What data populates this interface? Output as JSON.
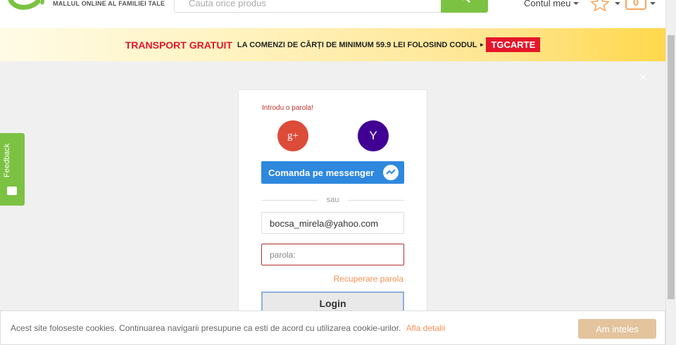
{
  "header": {
    "tagline": "MALLUL ONLINE AL FAMILIEI TALE",
    "search_placeholder": "Cauta orice produs",
    "account_label": "Contul meu",
    "cart_count": "0"
  },
  "promo": {
    "strong": "TRANSPORT GRATUIT",
    "text": "LA COMENZI DE CĂRȚI DE MINIMUM 59.9 LEI FOLOSIND CODUL",
    "arrow": "►",
    "code": "TGCARTE"
  },
  "overlay": {
    "close": "×"
  },
  "feedback": {
    "label": "Feedback"
  },
  "login": {
    "error": "Introdu o parola!",
    "google": "g+",
    "yahoo": "Y",
    "messenger_label": "Comanda pe messenger",
    "separator": "sau",
    "email_value": "bocsa_mirela@yahoo.com",
    "password_placeholder": "parola:",
    "recover_link": "Recuperare parola",
    "login_button": "Login"
  },
  "cookie": {
    "text": "Acest site foloseste cookies. Continuarea navigarii presupune ca esti de acord cu utilizarea cookie-urilor.",
    "link": "Afla detalii",
    "button": "Am inteles"
  },
  "colors": {
    "brand_green": "#7cc242",
    "promo_red": "#e5162a",
    "accent_orange": "#f79256",
    "google_red": "#dd4b39",
    "yahoo_purple": "#410093",
    "messenger_blue": "#2d88de"
  }
}
